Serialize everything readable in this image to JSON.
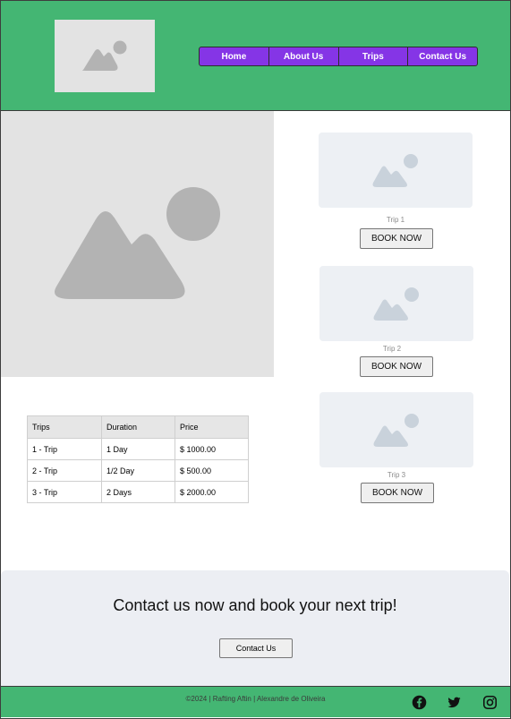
{
  "header": {
    "logo_icon": "image-placeholder-icon",
    "nav": [
      {
        "label": "Home"
      },
      {
        "label": "About Us"
      },
      {
        "label": "Trips"
      },
      {
        "label": "Contact Us"
      }
    ],
    "colors": {
      "header_bg": "#44b673",
      "nav_bg": "#8535e6"
    }
  },
  "hero": {
    "icon": "image-placeholder-icon"
  },
  "trips": [
    {
      "label": "Trip 1",
      "button": "BOOK NOW"
    },
    {
      "label": "Trip 2",
      "button": "BOOK NOW"
    },
    {
      "label": "Trip 3",
      "button": "BOOK NOW"
    }
  ],
  "table": {
    "headers": [
      "Trips",
      "Duration",
      "Price"
    ],
    "rows": [
      [
        "1 - Trip",
        "1 Day",
        "$ 1000.00"
      ],
      [
        "2 - Trip",
        "1/2 Day",
        "$ 500.00"
      ],
      [
        "3 - Trip",
        "2 Days",
        "$ 2000.00"
      ]
    ]
  },
  "cta": {
    "heading": "Contact us now and book your next trip!",
    "button": "Contact Us"
  },
  "footer": {
    "text": "©2024 | Rafting Aftin | Alexandre de Oliveira",
    "social": [
      "facebook-icon",
      "twitter-icon",
      "instagram-icon"
    ]
  }
}
